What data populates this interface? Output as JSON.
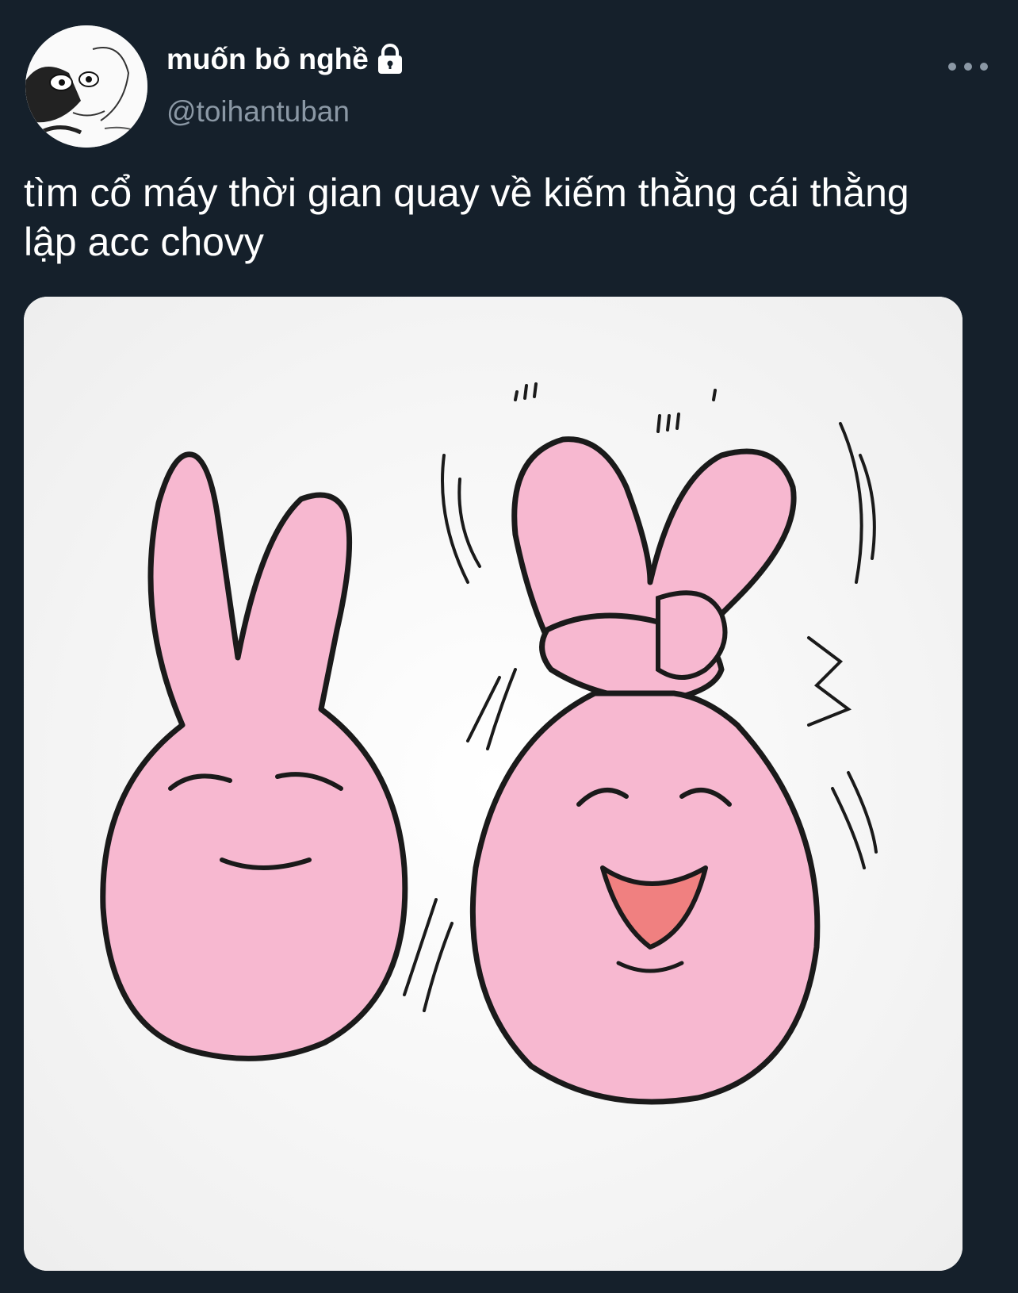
{
  "tweet": {
    "display_name": "muốn bỏ nghề",
    "handle": "@toihantuban",
    "text": "tìm cổ máy thời gian quay về kiếm thằng cái thằng lập acc chovy",
    "protected_icon": "lock-icon",
    "more_icon": "more-options-icon",
    "media_subject": "two pink bunny cartoon characters"
  },
  "colors": {
    "background": "#15202b",
    "secondary_text": "#8b98a5",
    "bunny_pink": "#f7b8d0",
    "tongue": "#f08080"
  }
}
